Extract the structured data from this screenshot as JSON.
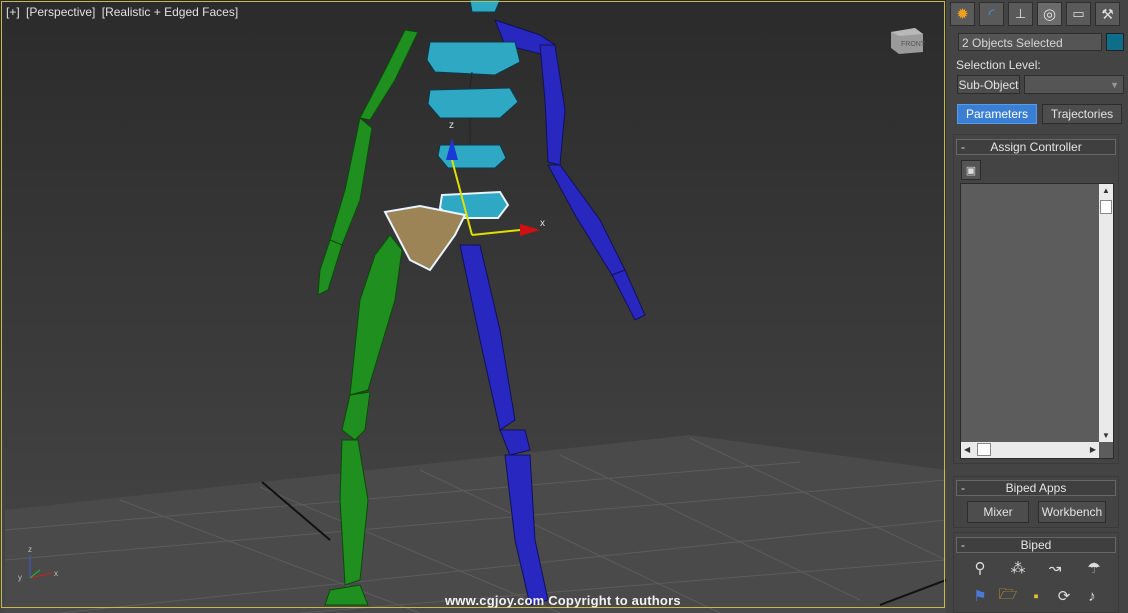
{
  "viewport": {
    "label_parts": [
      "[+]",
      "[Perspective]",
      "[Realistic + Edged Faces]"
    ],
    "viewcube_label": "FRONT",
    "gizmo_labels": {
      "x": "x",
      "z": "z"
    },
    "axis_tripod": {
      "x": "x",
      "y": "y",
      "z": "z"
    },
    "watermark": "www.cgjoy.com Copyright to authors",
    "colors": {
      "left_limbs": "#1e8c1e",
      "right_limbs": "#2222b8",
      "spine": "#2aa0b8",
      "pelvis": "#a88a4a"
    }
  },
  "command_panel": {
    "tabs": [
      "create-icon",
      "modify-icon",
      "hierarchy-icon",
      "motion-icon",
      "display-icon",
      "utilities-icon"
    ],
    "selection_field": "2 Objects Selected",
    "selection_color": "#0e6e8a",
    "selection_level_label": "Selection Level:",
    "sub_object_button": "Sub-Object",
    "sub_object_dropdown": "",
    "parameters_button": "Parameters",
    "trajectories_button": "Trajectories",
    "assign_controller": {
      "title": "Assign Controller",
      "collapse": "-"
    },
    "biped_apps": {
      "title": "Biped Apps",
      "collapse": "-",
      "mixer": "Mixer",
      "workbench": "Workbench"
    },
    "biped": {
      "title": "Biped",
      "collapse": "-"
    }
  }
}
